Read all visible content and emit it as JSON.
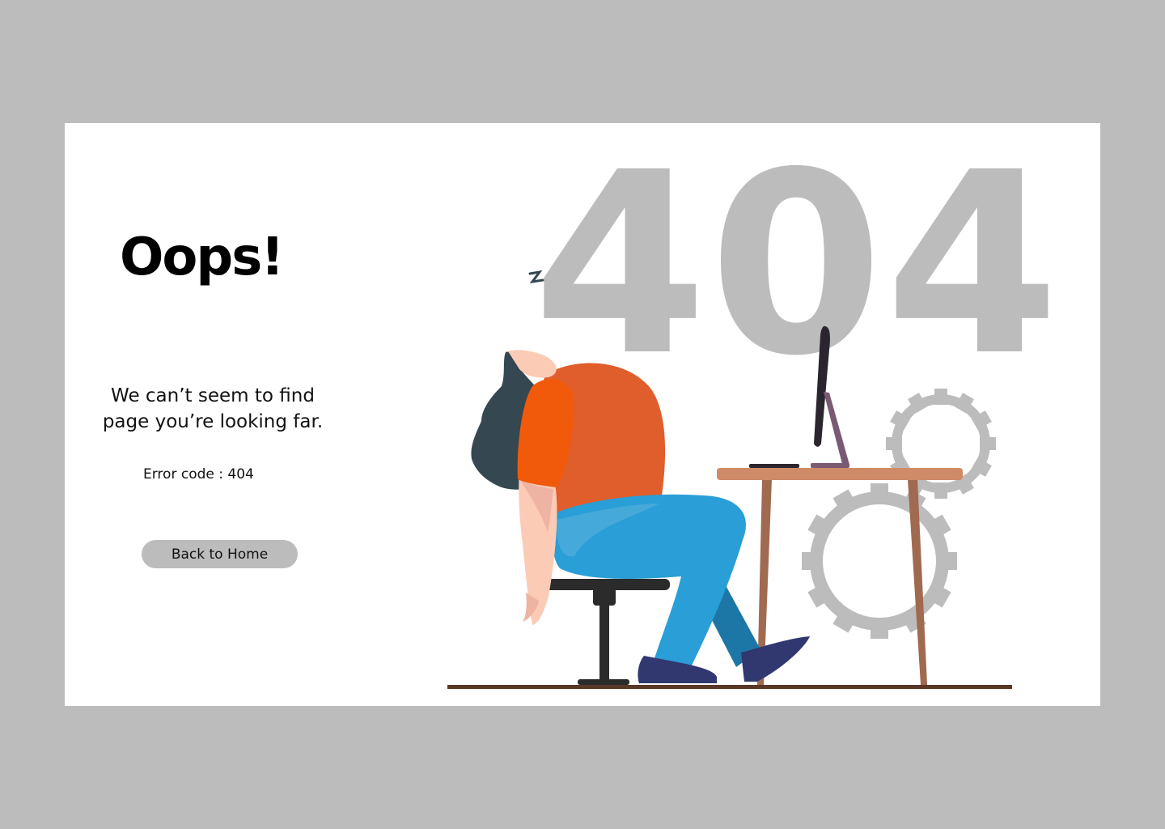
{
  "error": {
    "heading": "Oops!",
    "message": "We can’t seem to find page you’re looking far.",
    "code_text": "Error code : 404",
    "back_button_label": "Back to Home",
    "big_number": "404"
  },
  "colors": {
    "page_background": "#bcbcbc",
    "card_background": "#ffffff",
    "big_404": "#bcbcbc",
    "shirt": "#e05d2c",
    "sleeve": "#f25a0b",
    "pants": "#2a9ed6",
    "shoes": "#313870",
    "hair": "#354751",
    "skin": "#fccbb6",
    "desk_top": "#cf8a67",
    "desk_legs": "#a06a50",
    "floor": "#5b3725",
    "gears": "#bcbcbc",
    "monitor": "#2b2530"
  },
  "illustration": {
    "icons": [
      "gear-icon",
      "monitor-icon",
      "desk",
      "chair",
      "tired-person"
    ]
  }
}
